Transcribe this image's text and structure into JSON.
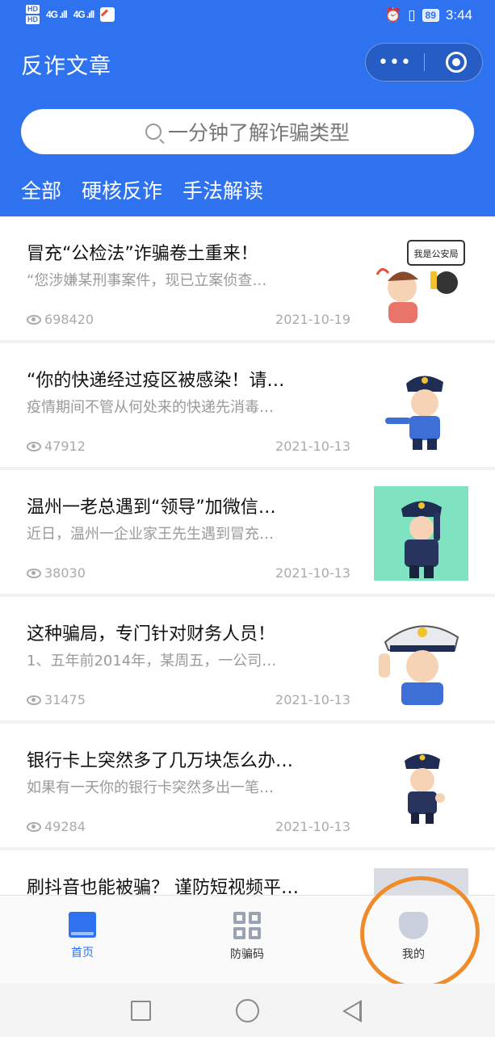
{
  "status_bar": {
    "hd_top": "HD",
    "hd_bottom": "HD",
    "signal_1": "4G .ıll",
    "signal_2": "4G .ıll",
    "alarm_icon": "alarm-icon",
    "vibrate_icon": "vibrate-icon",
    "battery": "89",
    "time": "3:44"
  },
  "header": {
    "title": "反诈文章",
    "more_glyph": "•••",
    "colors": {
      "header_bg": "#2f72f0",
      "accent": "#2f72f0",
      "highlight": "#ef8b2b"
    }
  },
  "search": {
    "placeholder": "一分钟了解诈骗类型"
  },
  "tabs": [
    {
      "label": "全部"
    },
    {
      "label": "硬核反诈"
    },
    {
      "label": "手法解读"
    }
  ],
  "articles": [
    {
      "title": "冒充“公检法”诈骗卷土重来！",
      "summary": "“您涉嫌某刑事案件，现已立案侦查…",
      "views": "698420",
      "date": "2021-10-19",
      "thumb_icon": "cartoon-phone-scam-illustration"
    },
    {
      "title": "“你的快递经过疫区被感染！请…",
      "summary": "疫情期间不管从何处来的快递先消毒…",
      "views": "47912",
      "date": "2021-10-13",
      "thumb_icon": "cartoon-police-pointing"
    },
    {
      "title": "温州一老总遇到“领导”加微信…",
      "summary": "近日，温州一企业家王先生遇到冒充…",
      "views": "38030",
      "date": "2021-10-13",
      "thumb_icon": "cartoon-police-saluting"
    },
    {
      "title": "这种骗局，专门针对财务人员！",
      "summary": "1、五年前2014年，某周五，一公司…",
      "views": "31475",
      "date": "2021-10-13",
      "thumb_icon": "cartoon-police-salute-closeup"
    },
    {
      "title": "银行卡上突然多了几万块怎么办…",
      "summary": "如果有一天你的银行卡突然多出一笔…",
      "views": "49284",
      "date": "2021-10-13",
      "thumb_icon": "cartoon-police-thumbs-up"
    },
    {
      "title": "刷抖音也能被骗？ 谨防短视频平…",
      "summary": "",
      "views": "",
      "date": "",
      "thumb_icon": "police-cap-photo"
    }
  ],
  "bottom_nav": [
    {
      "label": "首页",
      "icon": "book-icon"
    },
    {
      "label": "防骗码",
      "icon": "qr-code-icon"
    },
    {
      "label": "我的",
      "icon": "shield-icon"
    }
  ]
}
